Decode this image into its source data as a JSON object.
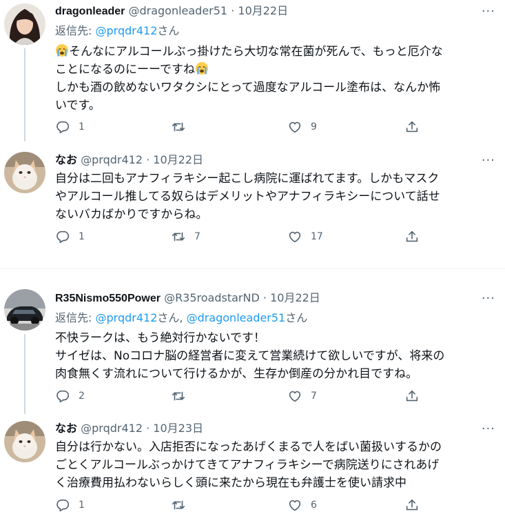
{
  "tweets": [
    {
      "name": "dragonleader",
      "handle": "@dragonleader51",
      "dot": "·",
      "date": "10月22日",
      "reply_prefix": "返信先: ",
      "reply_to": "@prqdr412",
      "reply_suffix": "さん",
      "body_lines": [
        "そんなにアルコールぶっ掛けたら大切な常在菌が死んで、もっと厄介な",
        "ことになるのにーーですね",
        "しかも酒の飲めないワタクシにとって過度なアルコール塗布は、なんか怖",
        "いです。"
      ],
      "replies": "1",
      "retweets": "",
      "likes": "9"
    },
    {
      "name": "なお",
      "handle": "@prqdr412",
      "dot": "·",
      "date": "10月22日",
      "body_lines": [
        "自分は二回もアナフィラキシー起こし病院に運ばれてます。しかもマスク",
        "やアルコール推してる奴らはデメリットやアナフィラキシーについて話せ",
        "ないバカばかりですからね。"
      ],
      "replies": "1",
      "retweets": "7",
      "likes": "17"
    },
    {
      "name": "R35Nismo550Power",
      "handle": "@R35roadstarND",
      "dot": "·",
      "date": "10月22日",
      "reply_prefix": "返信先: ",
      "reply_to": "@prqdr412",
      "reply_mid": "さん, ",
      "reply_to2": "@dragonleader51",
      "reply_suffix": "さん",
      "body_lines": [
        "不快ラークは、もう絶対行かないです！",
        "サイゼは、Noコロナ脳の経営者に変えて営業続けて欲しいですが、将来の",
        "肉食無くす流れについて行けるかが、生存か倒産の分かれ目ですね。"
      ],
      "replies": "2",
      "retweets": "",
      "likes": "7"
    },
    {
      "name": "なお",
      "handle": "@prqdr412",
      "dot": "·",
      "date": "10月23日",
      "body_lines": [
        "自分は行かない。入店拒否になったあげくまるで人をばい菌扱いするかの",
        "ごとくアルコールぶっかけてきてアナフィラキシーで病院送りにされあげ",
        "く治療費用払わないらしく頭に来たから現在も弁護士を使い請求中"
      ],
      "replies": "1",
      "retweets": "",
      "likes": "6"
    }
  ],
  "icons": {
    "reply": "reply-icon",
    "retweet": "retweet-icon",
    "like": "heart-icon",
    "share": "share-icon",
    "more": "more-icon",
    "emoji": "crying-face-emoji"
  },
  "colors": {
    "link": "#1d9bf0",
    "secondary": "#536471",
    "text": "#0f1419"
  },
  "more_glyph": "···"
}
